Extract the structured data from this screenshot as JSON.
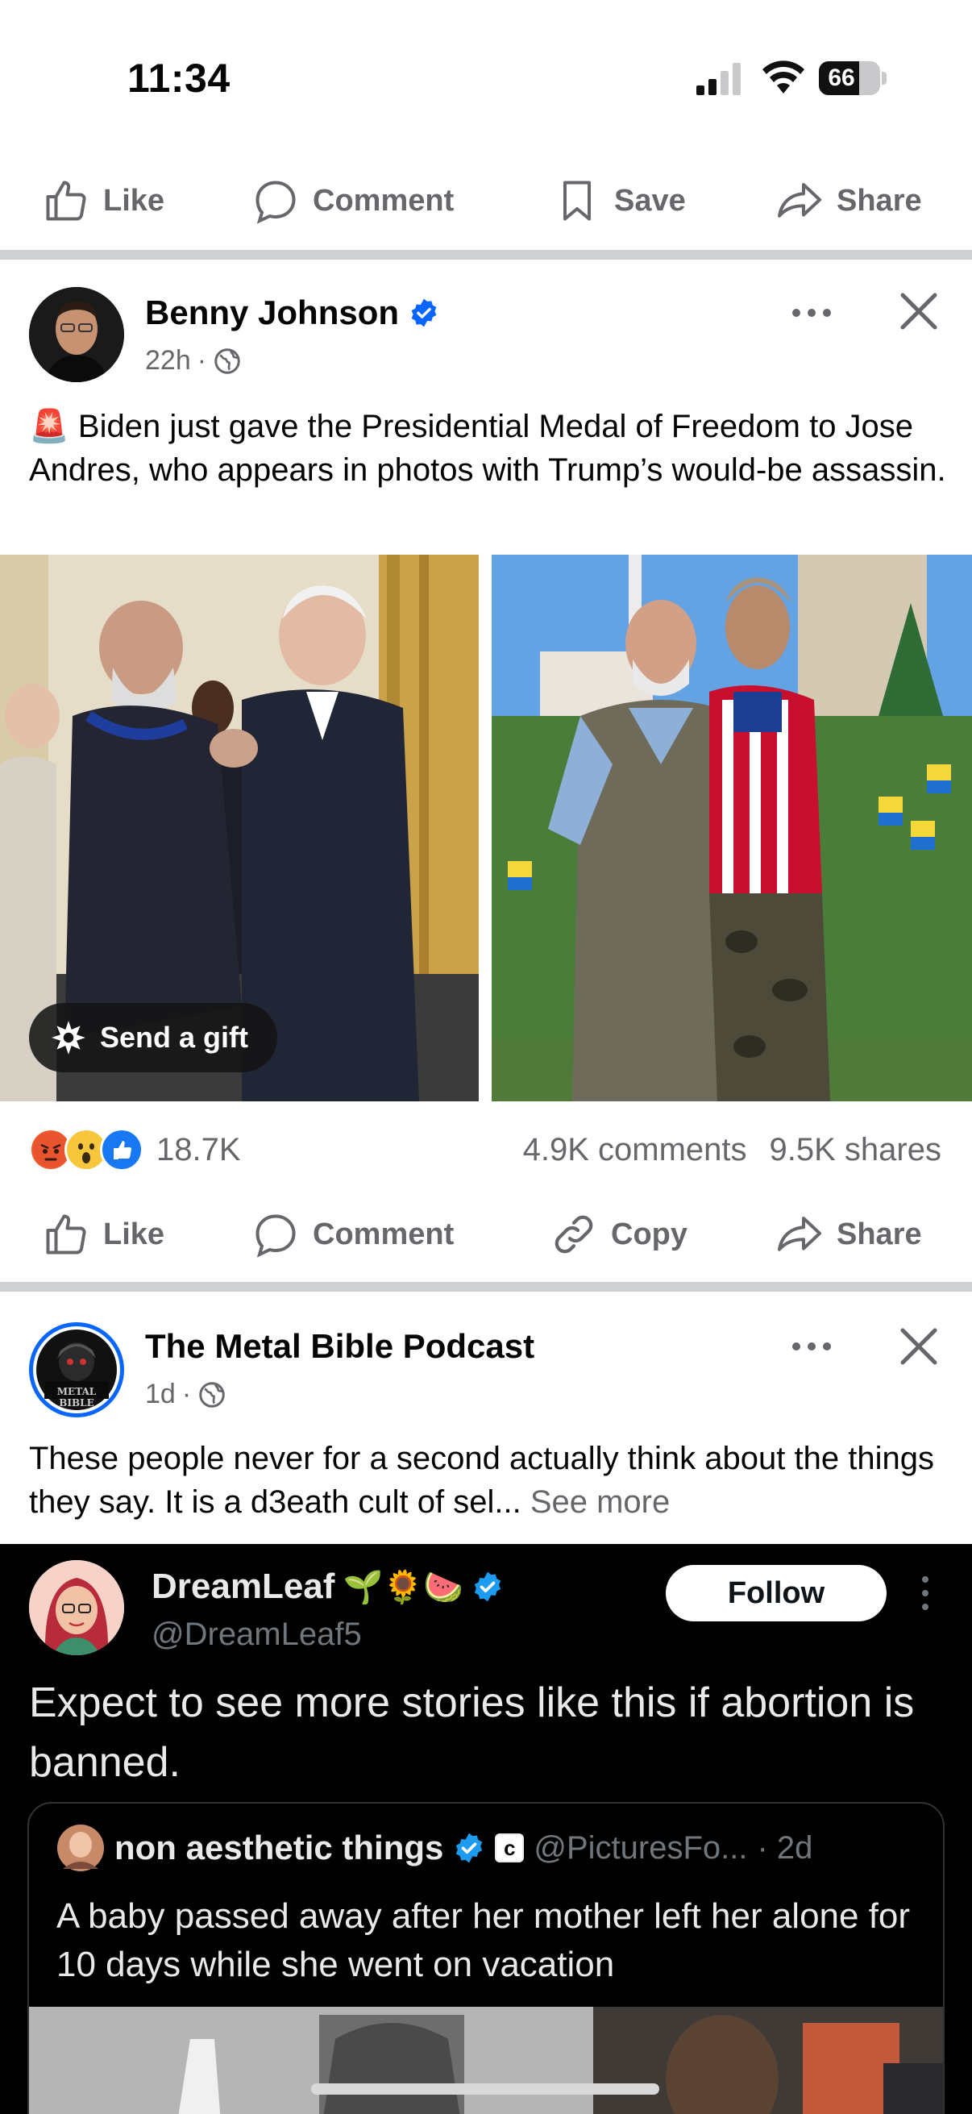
{
  "status_bar": {
    "time": "11:34",
    "battery_level": 66,
    "battery_text": "66"
  },
  "top_actions": {
    "like": "Like",
    "comment": "Comment",
    "save": "Save",
    "share": "Share"
  },
  "post1": {
    "author": "Benny Johnson",
    "verified": true,
    "time": "22h",
    "separator": "·",
    "text": "🚨 Biden just gave the Presidential Medal of Freedom to Jose Andres, who appears in photos with Trump’s would-be assassin.",
    "gift_button": "Send a gift",
    "reaction_count": "18.7K",
    "comments": "4.9K comments",
    "shares": "9.5K shares",
    "actions": {
      "like": "Like",
      "comment": "Comment",
      "copy": "Copy",
      "share": "Share"
    }
  },
  "post2": {
    "author": "The Metal Bible Podcast",
    "avatar_text": "METAL BIBLE",
    "time": "1d",
    "separator": "·",
    "text": "These people never for a second actually think about the things they say. It is a d3eath cult of sel...",
    "see_more": "See more",
    "tweet": {
      "name": "DreamLeaf",
      "emojis": "🌱🌻🍉",
      "handle": "@DreamLeaf5",
      "follow": "Follow",
      "text": "Expect to see more stories like this if abortion is banned.",
      "quote": {
        "name": "non aesthetic things",
        "badge_letter": "c",
        "handle": "@PicturesFo...",
        "time": "· 2d",
        "text": "A baby passed away after her mother left her alone for 10 days while she went on vacation"
      }
    }
  },
  "colors": {
    "facebook_blue": "#0866ff",
    "secondary_text": "#65676b",
    "divider": "#ced0d4",
    "twitter_bg": "#000000"
  }
}
